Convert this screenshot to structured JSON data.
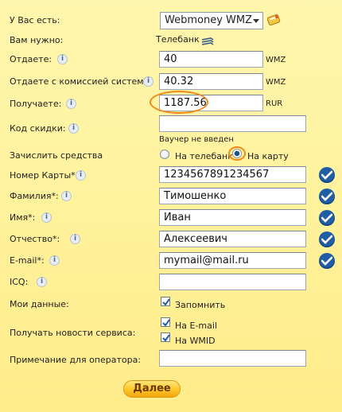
{
  "have": {
    "label": "У Вас есть:",
    "currency": "Webmoney WMZ"
  },
  "need": {
    "label": "Вам нужно:",
    "value": "Телебанк"
  },
  "give": {
    "label": "Отдаете:",
    "value": "40",
    "unit": "WMZ"
  },
  "give_fee": {
    "label": "Отдаете с комиссией системы:",
    "value": "40.32",
    "unit": "WMZ"
  },
  "receive": {
    "label": "Получаете:",
    "value": "1187.56",
    "unit": "RUR"
  },
  "discount": {
    "label": "Код скидки:",
    "value": "",
    "note": "Ваучер не введен"
  },
  "credit": {
    "label": "Зачислить средства",
    "option1": "На телебанк",
    "option2": "На карту",
    "selected": "option2"
  },
  "card": {
    "label": "Номер Карты*",
    "value": "1234567891234567"
  },
  "surname": {
    "label": "Фамилия*:",
    "value": "Тимошенко"
  },
  "name": {
    "label": "Имя*:",
    "value": "Иван"
  },
  "patronymic": {
    "label": "Отчество*:",
    "value": "Алексеевич"
  },
  "email": {
    "label": "E-mail*:",
    "value": "mymail@mail.ru"
  },
  "icq": {
    "label": "ICQ:",
    "value": ""
  },
  "my_data": {
    "label": "Мои данные:",
    "remember": "Запомнить",
    "checked": true
  },
  "news": {
    "label": "Получать новости сервиса:",
    "opt_email": "На E-mail",
    "opt_wmid": "На WMID",
    "email_checked": true,
    "wmid_checked": true
  },
  "note": {
    "label": "Примечание для оператора:",
    "value": ""
  },
  "submit": {
    "label": "Далее"
  },
  "colors": {
    "accent_blue": "#1f5ea5",
    "highlight_orange": "#f0891a",
    "button_gold": "#ffcc33"
  }
}
